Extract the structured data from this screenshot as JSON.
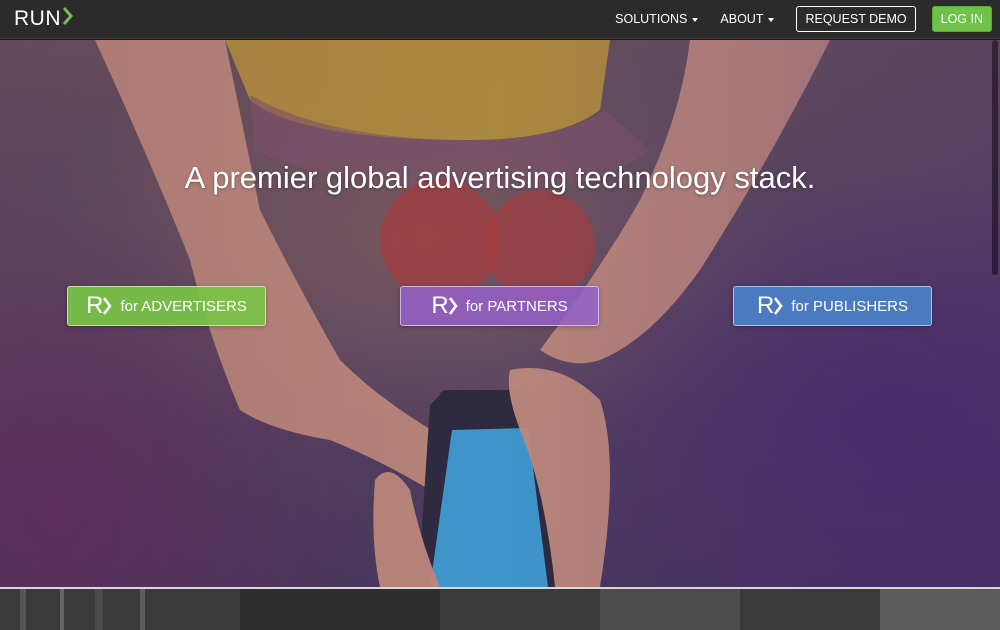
{
  "navbar": {
    "logo_text": "RUN",
    "links": [
      {
        "label": "SOLUTIONS"
      },
      {
        "label": "ABOUT"
      }
    ],
    "request_demo_label": "REQUEST DEMO",
    "login_label": "LOG IN"
  },
  "hero": {
    "headline": "A premier global advertising technology stack.",
    "ctas": [
      {
        "mark": "R",
        "label": "for ADVERTISERS",
        "color": "#7ac448"
      },
      {
        "mark": "R",
        "label": "for PARTNERS",
        "color": "#9460c8"
      },
      {
        "mark": "R",
        "label": "for PUBLISHERS",
        "color": "#4a80c8"
      }
    ]
  },
  "colors": {
    "navbar_bg": "#2b2b2b",
    "accent_green": "#6fc248",
    "logo_chevron": "#6fc248"
  },
  "icons": [
    "run-logo-chevron-icon",
    "caret-down-icon",
    "r-chevron-icon"
  ]
}
